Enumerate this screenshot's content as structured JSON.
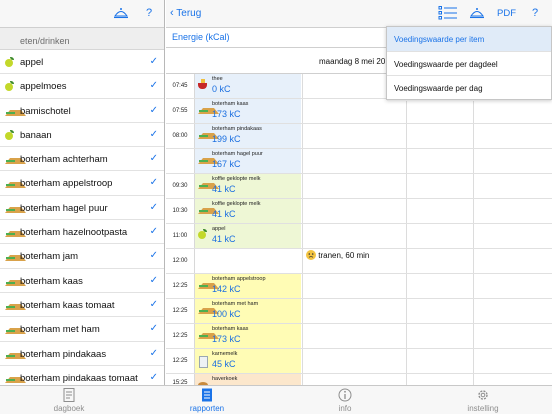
{
  "left": {
    "section_header": "eten/drinken",
    "help": "?",
    "items": [
      {
        "label": "appel",
        "icon": "apple-icon"
      },
      {
        "label": "appelmoes",
        "icon": "apple-icon"
      },
      {
        "label": "bamischotel",
        "icon": "sandwich-icon"
      },
      {
        "label": "banaan",
        "icon": "apple-icon"
      },
      {
        "label": "boterham achterham",
        "icon": "sandwich-icon"
      },
      {
        "label": "boterham appelstroop",
        "icon": "sandwich-icon"
      },
      {
        "label": "boterham hagel puur",
        "icon": "sandwich-icon"
      },
      {
        "label": "boterham hazelnootpasta",
        "icon": "sandwich-icon"
      },
      {
        "label": "boterham jam",
        "icon": "sandwich-icon"
      },
      {
        "label": "boterham kaas",
        "icon": "sandwich-icon"
      },
      {
        "label": "boterham kaas tomaat",
        "icon": "sandwich-icon"
      },
      {
        "label": "boterham met ham",
        "icon": "sandwich-icon"
      },
      {
        "label": "boterham pindakaas",
        "icon": "sandwich-icon"
      },
      {
        "label": "boterham pindakaas tomaat",
        "icon": "sandwich-icon"
      }
    ],
    "check_mark": "✓"
  },
  "right": {
    "back_label": "Terug",
    "pdf_label": "PDF",
    "help": "?",
    "subtitle": "Energie (kCal)",
    "date": "maandag 8 mei 20",
    "rows": [
      {
        "time": "07:45",
        "desc": "thee",
        "kc": "0 kC",
        "color": "bl",
        "icon": "tea-icon",
        "h": 25
      },
      {
        "time": "07:55",
        "desc": "boterham kaas",
        "kc": "173 kC",
        "color": "bl",
        "icon": "sandwich-icon",
        "h": 25
      },
      {
        "time": "08:00",
        "desc": "boterham pindakaas",
        "kc": "199 kC",
        "color": "bl",
        "icon": "sandwich-icon",
        "h": 25
      },
      {
        "time": "",
        "desc": "boterham hagel puur",
        "kc": "167 kC",
        "color": "bl",
        "icon": "sandwich-icon",
        "h": 25
      },
      {
        "time": "09:30",
        "desc": "koffie geklopte melk",
        "kc": "41 kC",
        "color": "gr",
        "icon": "sandwich-icon",
        "h": 25
      },
      {
        "time": "10:30",
        "desc": "koffie geklopte melk",
        "kc": "41 kC",
        "color": "gr",
        "icon": "sandwich-icon",
        "h": 25
      },
      {
        "time": "11:00",
        "desc": "appel",
        "kc": "41 kC",
        "color": "gr",
        "icon": "apple-icon",
        "h": 25
      },
      {
        "time": "12:00",
        "desc": "",
        "kc": "",
        "color": "",
        "icon": "",
        "h": 25
      },
      {
        "time": "12:25",
        "desc": "boterham appelstroop",
        "kc": "142 kC",
        "color": "ye",
        "icon": "sandwich-icon",
        "h": 25
      },
      {
        "time": "12:25",
        "desc": "boterham met ham",
        "kc": "100 kC",
        "color": "ye",
        "icon": "sandwich-icon",
        "h": 25
      },
      {
        "time": "12:25",
        "desc": "boterham kaas",
        "kc": "173 kC",
        "color": "ye",
        "icon": "sandwich-icon",
        "h": 25
      },
      {
        "time": "12:25",
        "desc": "karnemelk",
        "kc": "45 kC",
        "color": "ye",
        "icon": "milk-icon",
        "h": 25
      },
      {
        "time": "15:25",
        "desc": "haverkoek",
        "kc": "",
        "color": "or",
        "icon": "cookie-icon",
        "h": 20
      }
    ],
    "mood_note": "tranen, 60 min",
    "menu": [
      {
        "label": "Voedingswaarde per item",
        "selected": true
      },
      {
        "label": "Voedingswaarde per dagdeel",
        "selected": false
      },
      {
        "label": "Voedingswaarde per dag",
        "selected": false
      }
    ]
  },
  "tabs": [
    {
      "label": "dagboek",
      "icon": "notebook-icon",
      "active": false
    },
    {
      "label": "rapporten",
      "icon": "report-icon",
      "active": true
    },
    {
      "label": "info",
      "icon": "info-icon",
      "active": false
    },
    {
      "label": "instelling",
      "icon": "gear-icon",
      "active": false
    }
  ],
  "colors": {
    "accent": "#1a73e8",
    "breakfast": "#e7f0fa",
    "morning": "#eef7d5",
    "lunch": "#fffcb5",
    "afternoon": "#fce7cc"
  }
}
